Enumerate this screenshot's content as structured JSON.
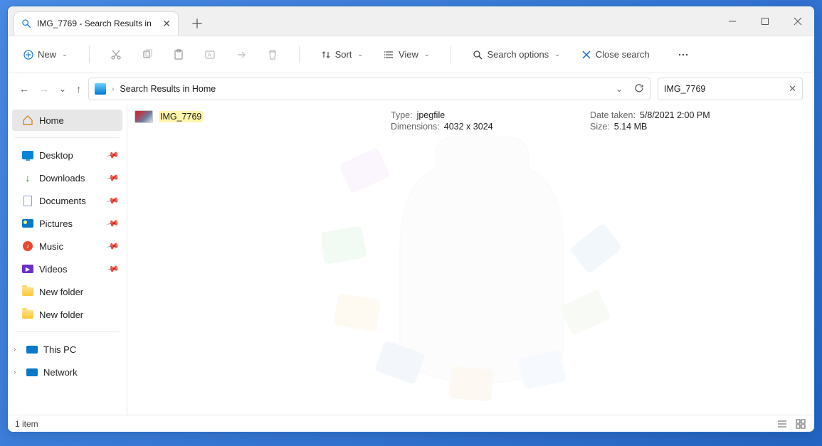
{
  "window": {
    "tab_title": "IMG_7769 - Search Results in"
  },
  "toolbar": {
    "new_label": "New",
    "sort_label": "Sort",
    "view_label": "View",
    "search_options_label": "Search options",
    "close_search_label": "Close search"
  },
  "address": {
    "path_label": "Search Results in Home"
  },
  "search": {
    "value": "IMG_7769"
  },
  "sidebar": {
    "home": "Home",
    "items": [
      {
        "label": "Desktop"
      },
      {
        "label": "Downloads"
      },
      {
        "label": "Documents"
      },
      {
        "label": "Pictures"
      },
      {
        "label": "Music"
      },
      {
        "label": "Videos"
      },
      {
        "label": "New folder"
      },
      {
        "label": "New folder"
      }
    ],
    "this_pc": "This PC",
    "network": "Network"
  },
  "result": {
    "filename": "IMG_7769",
    "meta": {
      "type_label": "Type:",
      "type_value": "jpegfile",
      "dimensions_label": "Dimensions:",
      "dimensions_value": "4032 x 3024",
      "date_label": "Date taken:",
      "date_value": "5/8/2021 2:00 PM",
      "size_label": "Size:",
      "size_value": "5.14 MB"
    }
  },
  "status": {
    "items_text": "1 item"
  }
}
